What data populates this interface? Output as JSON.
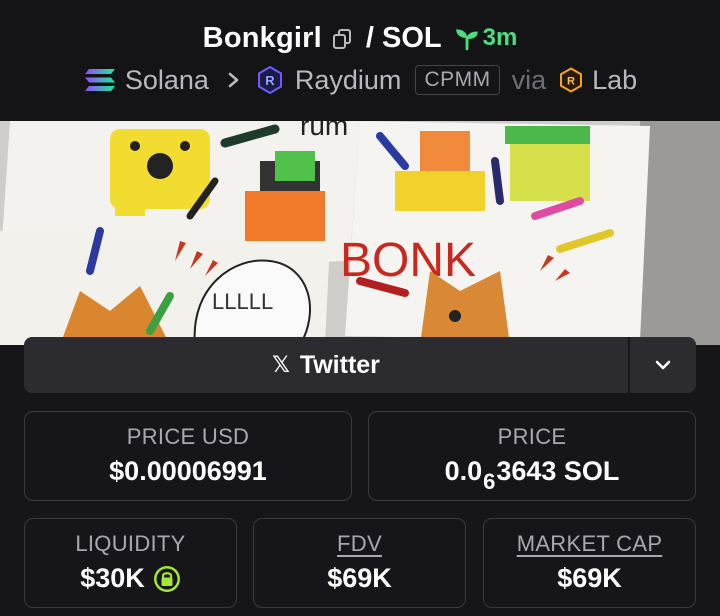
{
  "header": {
    "token_name": "Bonkgirl",
    "quote_separator": "/ SOL",
    "age": "3m",
    "chain": "Solana",
    "dex": "Raydium",
    "pool_type": "CPMM",
    "via": "via",
    "launchpad": "Lab",
    "icons": [
      "copy-icon",
      "sprout-icon",
      "solana-icon",
      "chevron-right-icon",
      "raydium-icon",
      "raydium-lab-icon"
    ]
  },
  "banner": {
    "description_text": "BONK",
    "drawing_words": "rum",
    "speech_text": "LLLLL"
  },
  "social": {
    "twitter_label": "Twitter",
    "x_glyph": "𝕏"
  },
  "stats": {
    "price_usd_label": "PRICE USD",
    "price_usd_value": "$0.00006991",
    "price_label": "PRICE",
    "price_prefix": "0.0",
    "price_zeros": "6",
    "price_suffix": "3643 SOL",
    "liquidity_label": "LIQUIDITY",
    "liquidity_value": "$30K",
    "fdv_label": "FDV",
    "fdv_value": "$69K",
    "mcap_label": "MARKET CAP",
    "mcap_value": "$69K"
  },
  "colors": {
    "accent_green": "#4ade80",
    "lock_green": "#a3e635",
    "background": "#16161a"
  }
}
